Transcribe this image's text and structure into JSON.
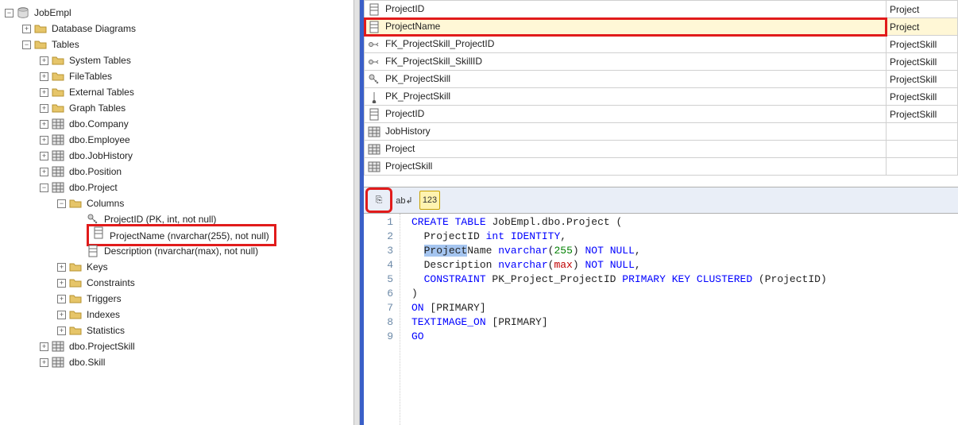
{
  "tree": {
    "root": "JobEmpl",
    "diagrams": "Database Diagrams",
    "tables": "Tables",
    "systemTables": "System Tables",
    "fileTables": "FileTables",
    "externalTables": "External Tables",
    "graphTables": "Graph Tables",
    "dboCompany": "dbo.Company",
    "dboEmployee": "dbo.Employee",
    "dboJobHistory": "dbo.JobHistory",
    "dboPosition": "dbo.Position",
    "dboProject": "dbo.Project",
    "columns": "Columns",
    "col_projectid": "ProjectID (PK, int, not null)",
    "col_projectname": "ProjectName (nvarchar(255), not null)",
    "col_description": "Description (nvarchar(max), not null)",
    "keys": "Keys",
    "constraints": "Constraints",
    "triggers": "Triggers",
    "indexes": "Indexes",
    "statistics": "Statistics",
    "dboProjectSkill": "dbo.ProjectSkill",
    "dboSkill": "dbo.Skill"
  },
  "grid": {
    "rows": [
      {
        "icon": "column",
        "name": "ProjectID",
        "type": "Project"
      },
      {
        "icon": "column",
        "name": "ProjectName",
        "type": "Project",
        "selected": true
      },
      {
        "icon": "fk",
        "name": "FK_ProjectSkill_ProjectID",
        "type": "ProjectSkill"
      },
      {
        "icon": "fk",
        "name": "FK_ProjectSkill_SkillID",
        "type": "ProjectSkill"
      },
      {
        "icon": "pk",
        "name": "PK_ProjectSkill",
        "type": "ProjectSkill"
      },
      {
        "icon": "index",
        "name": "PK_ProjectSkill",
        "type": "ProjectSkill"
      },
      {
        "icon": "column",
        "name": "ProjectID",
        "type": "ProjectSkill"
      },
      {
        "icon": "table",
        "name": "JobHistory",
        "type": ""
      },
      {
        "icon": "table",
        "name": "Project",
        "type": ""
      },
      {
        "icon": "table",
        "name": "ProjectSkill",
        "type": ""
      }
    ]
  },
  "toolbar": {
    "btn1": "⎘",
    "btn2": "ab↲",
    "btn3": "123"
  },
  "code": {
    "lines": [
      {
        "n": 1,
        "tokens": [
          {
            "t": "CREATE",
            "c": "kw"
          },
          {
            "t": " "
          },
          {
            "t": "TABLE",
            "c": "kw"
          },
          {
            "t": " JobEmpl.dbo.Project ("
          }
        ]
      },
      {
        "n": 2,
        "tokens": [
          {
            "t": "  ProjectID "
          },
          {
            "t": "int",
            "c": "kw"
          },
          {
            "t": " "
          },
          {
            "t": "IDENTITY",
            "c": "kw"
          },
          {
            "t": ","
          }
        ]
      },
      {
        "n": 3,
        "tokens": [
          {
            "t": "  "
          },
          {
            "t": "Project",
            "c": "sel-token"
          },
          {
            "t": "Name "
          },
          {
            "t": "nvarchar",
            "c": "kw"
          },
          {
            "t": "("
          },
          {
            "t": "255",
            "c": "num"
          },
          {
            "t": ") "
          },
          {
            "t": "NOT",
            "c": "kw"
          },
          {
            "t": " "
          },
          {
            "t": "NULL",
            "c": "kw"
          },
          {
            "t": ","
          }
        ]
      },
      {
        "n": 4,
        "tokens": [
          {
            "t": "  Description "
          },
          {
            "t": "nvarchar",
            "c": "kw"
          },
          {
            "t": "("
          },
          {
            "t": "max",
            "c": "max"
          },
          {
            "t": ") "
          },
          {
            "t": "NOT",
            "c": "kw"
          },
          {
            "t": " "
          },
          {
            "t": "NULL",
            "c": "kw"
          },
          {
            "t": ","
          }
        ]
      },
      {
        "n": 5,
        "tokens": [
          {
            "t": "  "
          },
          {
            "t": "CONSTRAINT",
            "c": "kw"
          },
          {
            "t": " PK_Project_ProjectID "
          },
          {
            "t": "PRIMARY",
            "c": "kw"
          },
          {
            "t": " "
          },
          {
            "t": "KEY",
            "c": "kw"
          },
          {
            "t": " "
          },
          {
            "t": "CLUSTERED",
            "c": "kw"
          },
          {
            "t": " (ProjectID)"
          }
        ]
      },
      {
        "n": 6,
        "tokens": [
          {
            "t": ")"
          }
        ]
      },
      {
        "n": 7,
        "tokens": [
          {
            "t": "ON",
            "c": "kw"
          },
          {
            "t": " [PRIMARY]"
          }
        ]
      },
      {
        "n": 8,
        "tokens": [
          {
            "t": "TEXTIMAGE_ON",
            "c": "kw"
          },
          {
            "t": " [PRIMARY]"
          }
        ]
      },
      {
        "n": 9,
        "tokens": [
          {
            "t": "GO",
            "c": "kw"
          }
        ]
      }
    ]
  }
}
